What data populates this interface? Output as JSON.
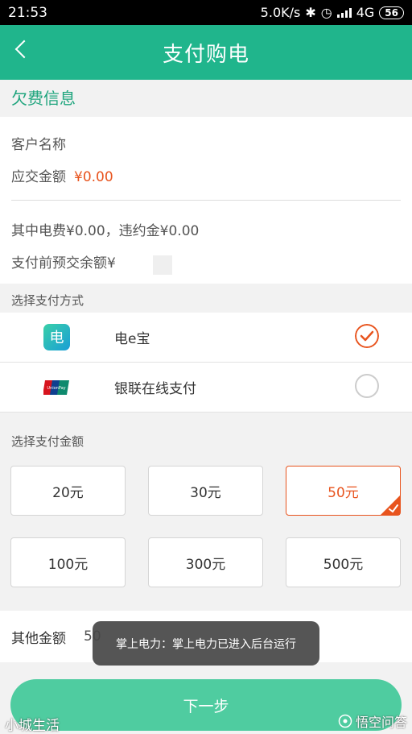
{
  "status_bar": {
    "time": "21:53",
    "speed": "5.0K/s",
    "network": "4G",
    "battery": "56"
  },
  "header": {
    "title": "支付购电"
  },
  "arrears": {
    "title": "欠费信息",
    "customer_name_label": "客户名称",
    "amount_due_label": "应交金额",
    "amount_due_value": "¥0.00",
    "breakdown": "其中电费¥0.00，违约金¥0.00",
    "prepaid_balance_label": "支付前预交余额¥"
  },
  "payment_method": {
    "title": "选择支付方式",
    "options": [
      {
        "label": "电e宝",
        "icon": "dianebao-icon",
        "checked": true
      },
      {
        "label": "银联在线支付",
        "icon": "unionpay-icon",
        "checked": false
      }
    ]
  },
  "amount": {
    "title": "选择支付金额",
    "options": [
      "20元",
      "30元",
      "50元",
      "100元",
      "300元",
      "500元"
    ],
    "selected": "50元"
  },
  "other_amount": {
    "label": "其他金额",
    "value": "50"
  },
  "toast": {
    "text": "掌上电力：掌上电力已进入后台运行"
  },
  "next_button": {
    "label": "下一步"
  },
  "watermarks": {
    "left": "小城生活",
    "right": "悟空问答"
  },
  "colors": {
    "primary": "#20b58c",
    "accent": "#e8541e",
    "button": "#4fcca0"
  }
}
